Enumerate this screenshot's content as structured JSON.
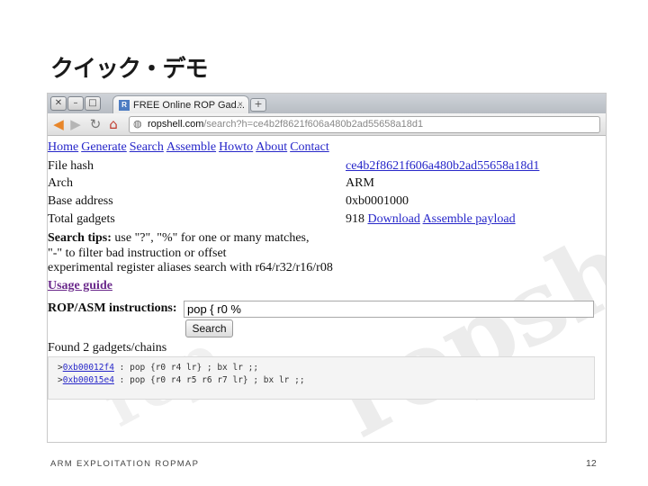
{
  "slide": {
    "title": "クイック・デモ",
    "footer_left": "ARM EXPLOITATION ROPMAP",
    "page_number": "12"
  },
  "browser": {
    "tab_title": "FREE Online ROP Gad...",
    "tab_close": "×",
    "new_tab": "+",
    "url_host": "ropshell.com",
    "url_path": "/search?h=ce4b2f8621f606a480b2ad55658a18d1",
    "icons": [
      "back-arrow-icon",
      "forward-arrow-icon",
      "reload-icon",
      "home-icon",
      "globe-icon"
    ]
  },
  "page": {
    "menu": [
      "Home",
      "Generate",
      "Search",
      "Assemble",
      "Howto",
      "About",
      "Contact"
    ],
    "info": [
      {
        "label": "File hash",
        "value": "ce4b2f8621f606a480b2ad55658a18d1"
      },
      {
        "label": "Arch",
        "value": "ARM"
      },
      {
        "label": "Base address",
        "value": "0xb0001000"
      },
      {
        "label": "Total gadgets",
        "value": "918"
      }
    ],
    "download_link": "Download",
    "assemble_link": "Assemble payload",
    "tips_label": "Search tips:",
    "tips_line1": " use \"?\", \"%\" for one or many matches,",
    "tips_line2": "\"-\" to filter bad instruction or offset",
    "tips_line3": "experimental register aliases search with r64/r32/r16/r08",
    "usage_guide": "Usage guide",
    "rop_label": "ROP/ASM instructions:",
    "rop_value": "pop { r0 %",
    "search_button": "Search",
    "found_text": "Found 2 gadgets/chains",
    "gadgets": [
      {
        "addr": "0xb00012f4",
        "code": " : pop {r0 r4 lr} ; bx lr ;;"
      },
      {
        "addr": "0xb00015e4",
        "code": " : pop {r0 r4 r5 r6 r7 lr} ; bx lr ;;"
      }
    ]
  },
  "colors": {
    "link": "#2727c9",
    "visited": "#6b2a8c",
    "back_arrow": "#e8862a",
    "home": "#c0392b"
  }
}
